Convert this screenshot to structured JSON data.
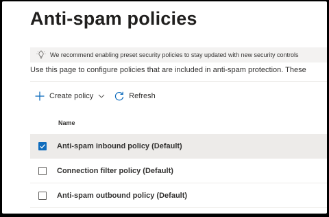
{
  "page": {
    "title": "Anti-spam policies"
  },
  "banner": {
    "icon": "lightbulb-icon",
    "text": "We recommend enabling preset security policies to stay updated with new security controls"
  },
  "intro": "Use this page to configure policies that are included in anti-spam protection. These",
  "toolbar": {
    "create_label": "Create policy",
    "refresh_label": "Refresh"
  },
  "table": {
    "header_name": "Name",
    "rows": [
      {
        "name": "Anti-spam inbound policy (Default)",
        "checked": true
      },
      {
        "name": "Connection filter policy (Default)",
        "checked": false
      },
      {
        "name": "Anti-spam outbound policy (Default)",
        "checked": false
      }
    ]
  },
  "colors": {
    "accent": "#0f6cbd",
    "selected_row": "#edebe9",
    "banner_bg": "#f3f2f1"
  }
}
